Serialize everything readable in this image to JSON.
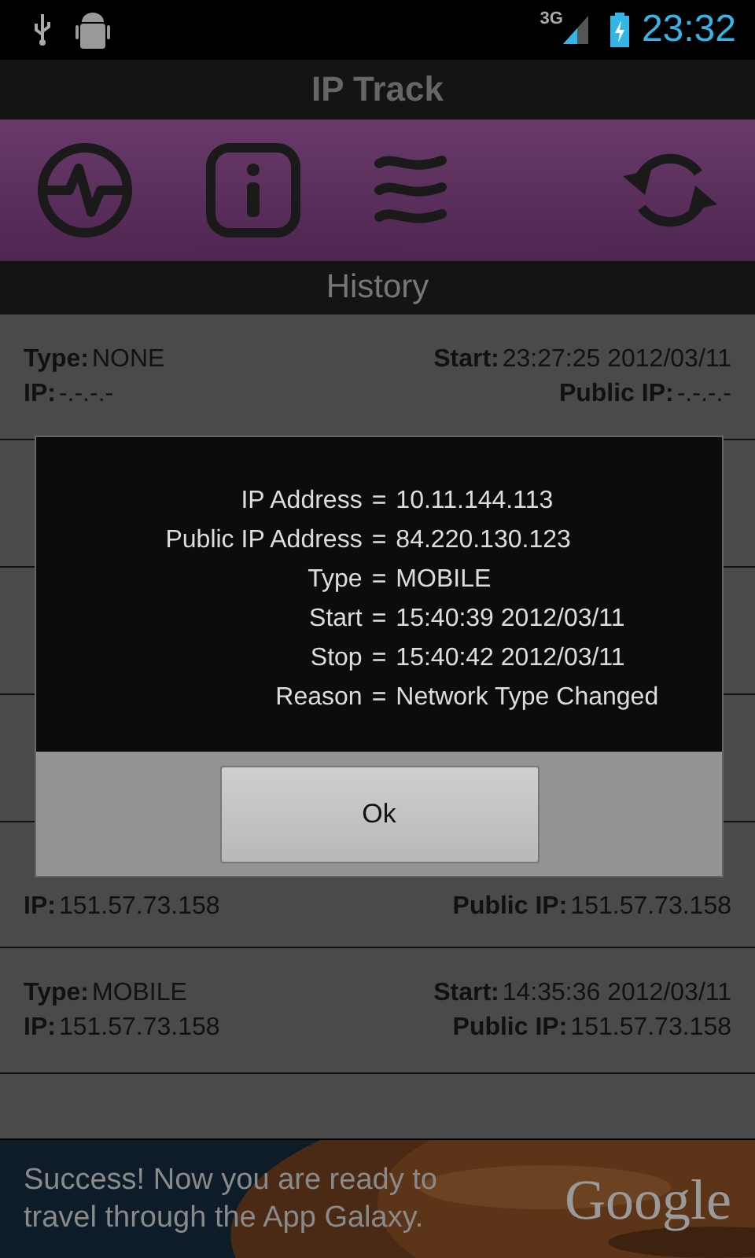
{
  "status_bar": {
    "time": "23:32",
    "network": "3G"
  },
  "app_title": "IP Track",
  "section_title": "History",
  "history_top": [
    {
      "type_label": "Type:",
      "type": "NONE",
      "start_label": "Start:",
      "start": "23:27:25 2012/03/11",
      "ip_label": "IP:",
      "ip": "-.-.-.-",
      "public_ip_label": "Public IP:",
      "public_ip": "-.-.-.-"
    }
  ],
  "history_partial": {
    "ip_label": "IP:",
    "ip": "151.57.73.158",
    "public_ip_label": "Public IP:",
    "public_ip": "151.57.73.158"
  },
  "history_bottom": [
    {
      "type_label": "Type:",
      "type": "MOBILE",
      "start_label": "Start:",
      "start": "14:35:36 2012/03/11",
      "ip_label": "IP:",
      "ip": "151.57.73.158",
      "public_ip_label": "Public IP:",
      "public_ip": "151.57.73.158"
    }
  ],
  "dialog": {
    "lines": [
      {
        "label": "IP Address",
        "value": "10.11.144.113"
      },
      {
        "label": "Public IP Address",
        "value": "84.220.130.123"
      },
      {
        "label": "Type",
        "value": "MOBILE"
      },
      {
        "label": "Start",
        "value": "15:40:39 2012/03/11"
      },
      {
        "label": "Stop",
        "value": "15:40:42 2012/03/11"
      },
      {
        "label": "Reason",
        "value": "Network Type Changed"
      }
    ],
    "separator": "=",
    "button": "Ok"
  },
  "ad": {
    "text": "Success! Now you are ready to travel through the App Galaxy.",
    "brand": "Google"
  }
}
